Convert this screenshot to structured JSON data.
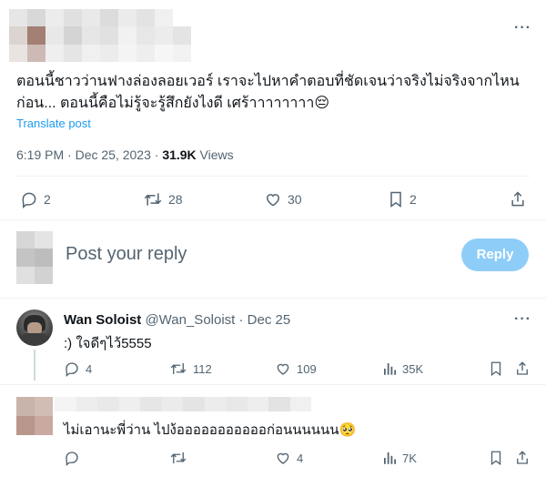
{
  "main_tweet": {
    "text_line1": "ตอนนี้ชาวว่านฟางล่องลอยเวอร์ เราจะไปหาคำตอบที่ชัดเจนว่าจริงไม่จริงจากไหน",
    "text_line2": "ก่อน... ตอนนี้คือไม่รู้จะรู้สึกยังไงดี เศร้าาาาาาาา",
    "emoji": "😔",
    "translate_label": "Translate post",
    "time": "6:19 PM · Dec 25, 2023 · ",
    "views_count": "31.9K",
    "views_label": " Views",
    "stats": {
      "replies": "2",
      "reposts": "28",
      "likes": "30",
      "bookmarks": "2"
    }
  },
  "reply_box": {
    "placeholder": "Post your reply",
    "button_label": "Reply"
  },
  "replies": [
    {
      "name": "Wan Soloist",
      "handle": "@Wan_Soloist",
      "date": "· Dec 25",
      "text": ":) ใจดีๆไว้5555",
      "stats": {
        "replies": "4",
        "reposts": "112",
        "likes": "109",
        "views": "35K"
      }
    },
    {
      "text": "ไม่เอานะพี่ว่าน ไปง้อออออออออออก่อนนนนนน",
      "emoji": "🥺",
      "stats": {
        "likes": "4",
        "views": "7K"
      }
    }
  ],
  "icons": [
    "more-icon",
    "reply-icon",
    "repost-icon",
    "like-icon",
    "bookmark-icon",
    "share-icon",
    "views-icon"
  ],
  "colors": {
    "accent": "#1d9bf0",
    "reply_button": "#8ecdf8",
    "muted": "#536471"
  }
}
